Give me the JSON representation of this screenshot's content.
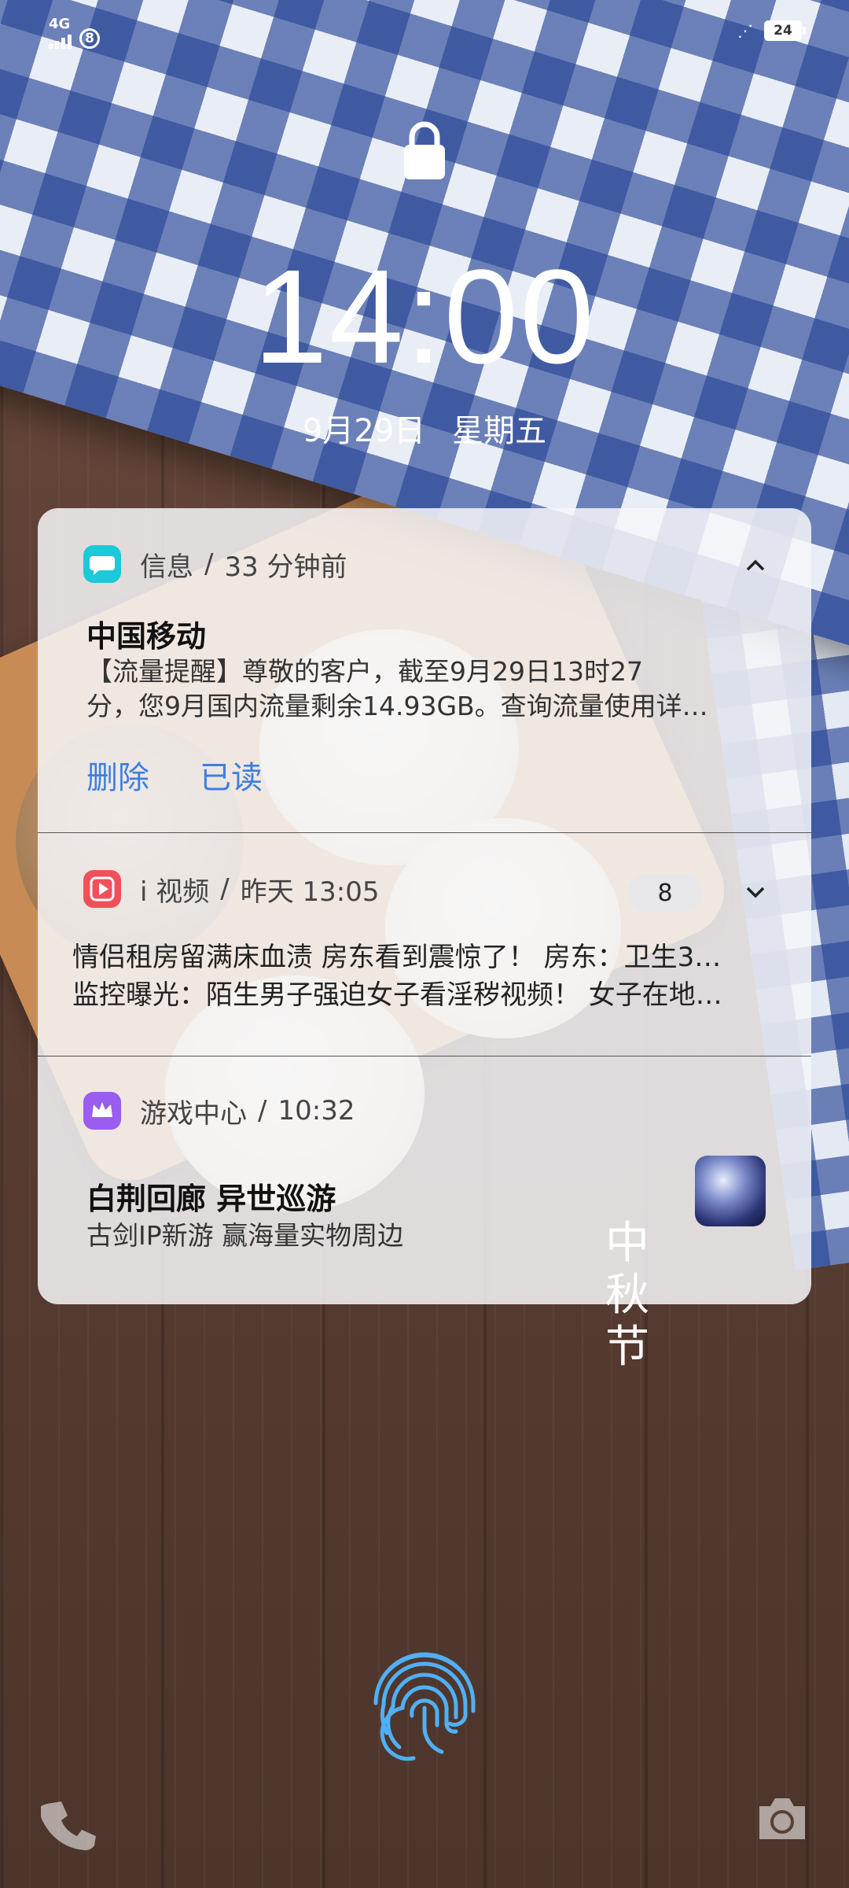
{
  "status_bar": {
    "network": "4G",
    "notification_count": "8",
    "battery": "24"
  },
  "lock_screen": {
    "time": "14:00",
    "date": "9月29日",
    "weekday": "星期五"
  },
  "notifications": [
    {
      "app": "信息",
      "time": "33 分钟前",
      "title": "中国移动",
      "body_line1": "【流量提醒】尊敬的客户，截至9月29日13时27",
      "body_line2": "分，您9月国内流量剩余14.93GB。查询流量使用详…",
      "actions": [
        "删除",
        "已读"
      ],
      "expanded": true,
      "icon": "message-icon",
      "icon_color": "#1cc9d8"
    },
    {
      "app": "i 视频",
      "time": "昨天 13:05",
      "count": "8",
      "lines": [
        "情侣租房留满床血渍 房东看到震惊了！  房东：卫生3…",
        "监控曝光：陌生男子强迫女子看淫秽视频！  女子在地…"
      ],
      "expanded": false,
      "icon": "video-play-icon",
      "icon_color": "#f0505a"
    },
    {
      "app": "游戏中心",
      "time": "10:32",
      "title": "白荆回廊 异世巡游",
      "body": "古剑IP新游 赢海量实物周边",
      "icon": "crown-icon",
      "icon_color": "#9b5cf0"
    }
  ],
  "separator": "/",
  "wallpaper_text": [
    "中",
    "秋",
    "节"
  ]
}
